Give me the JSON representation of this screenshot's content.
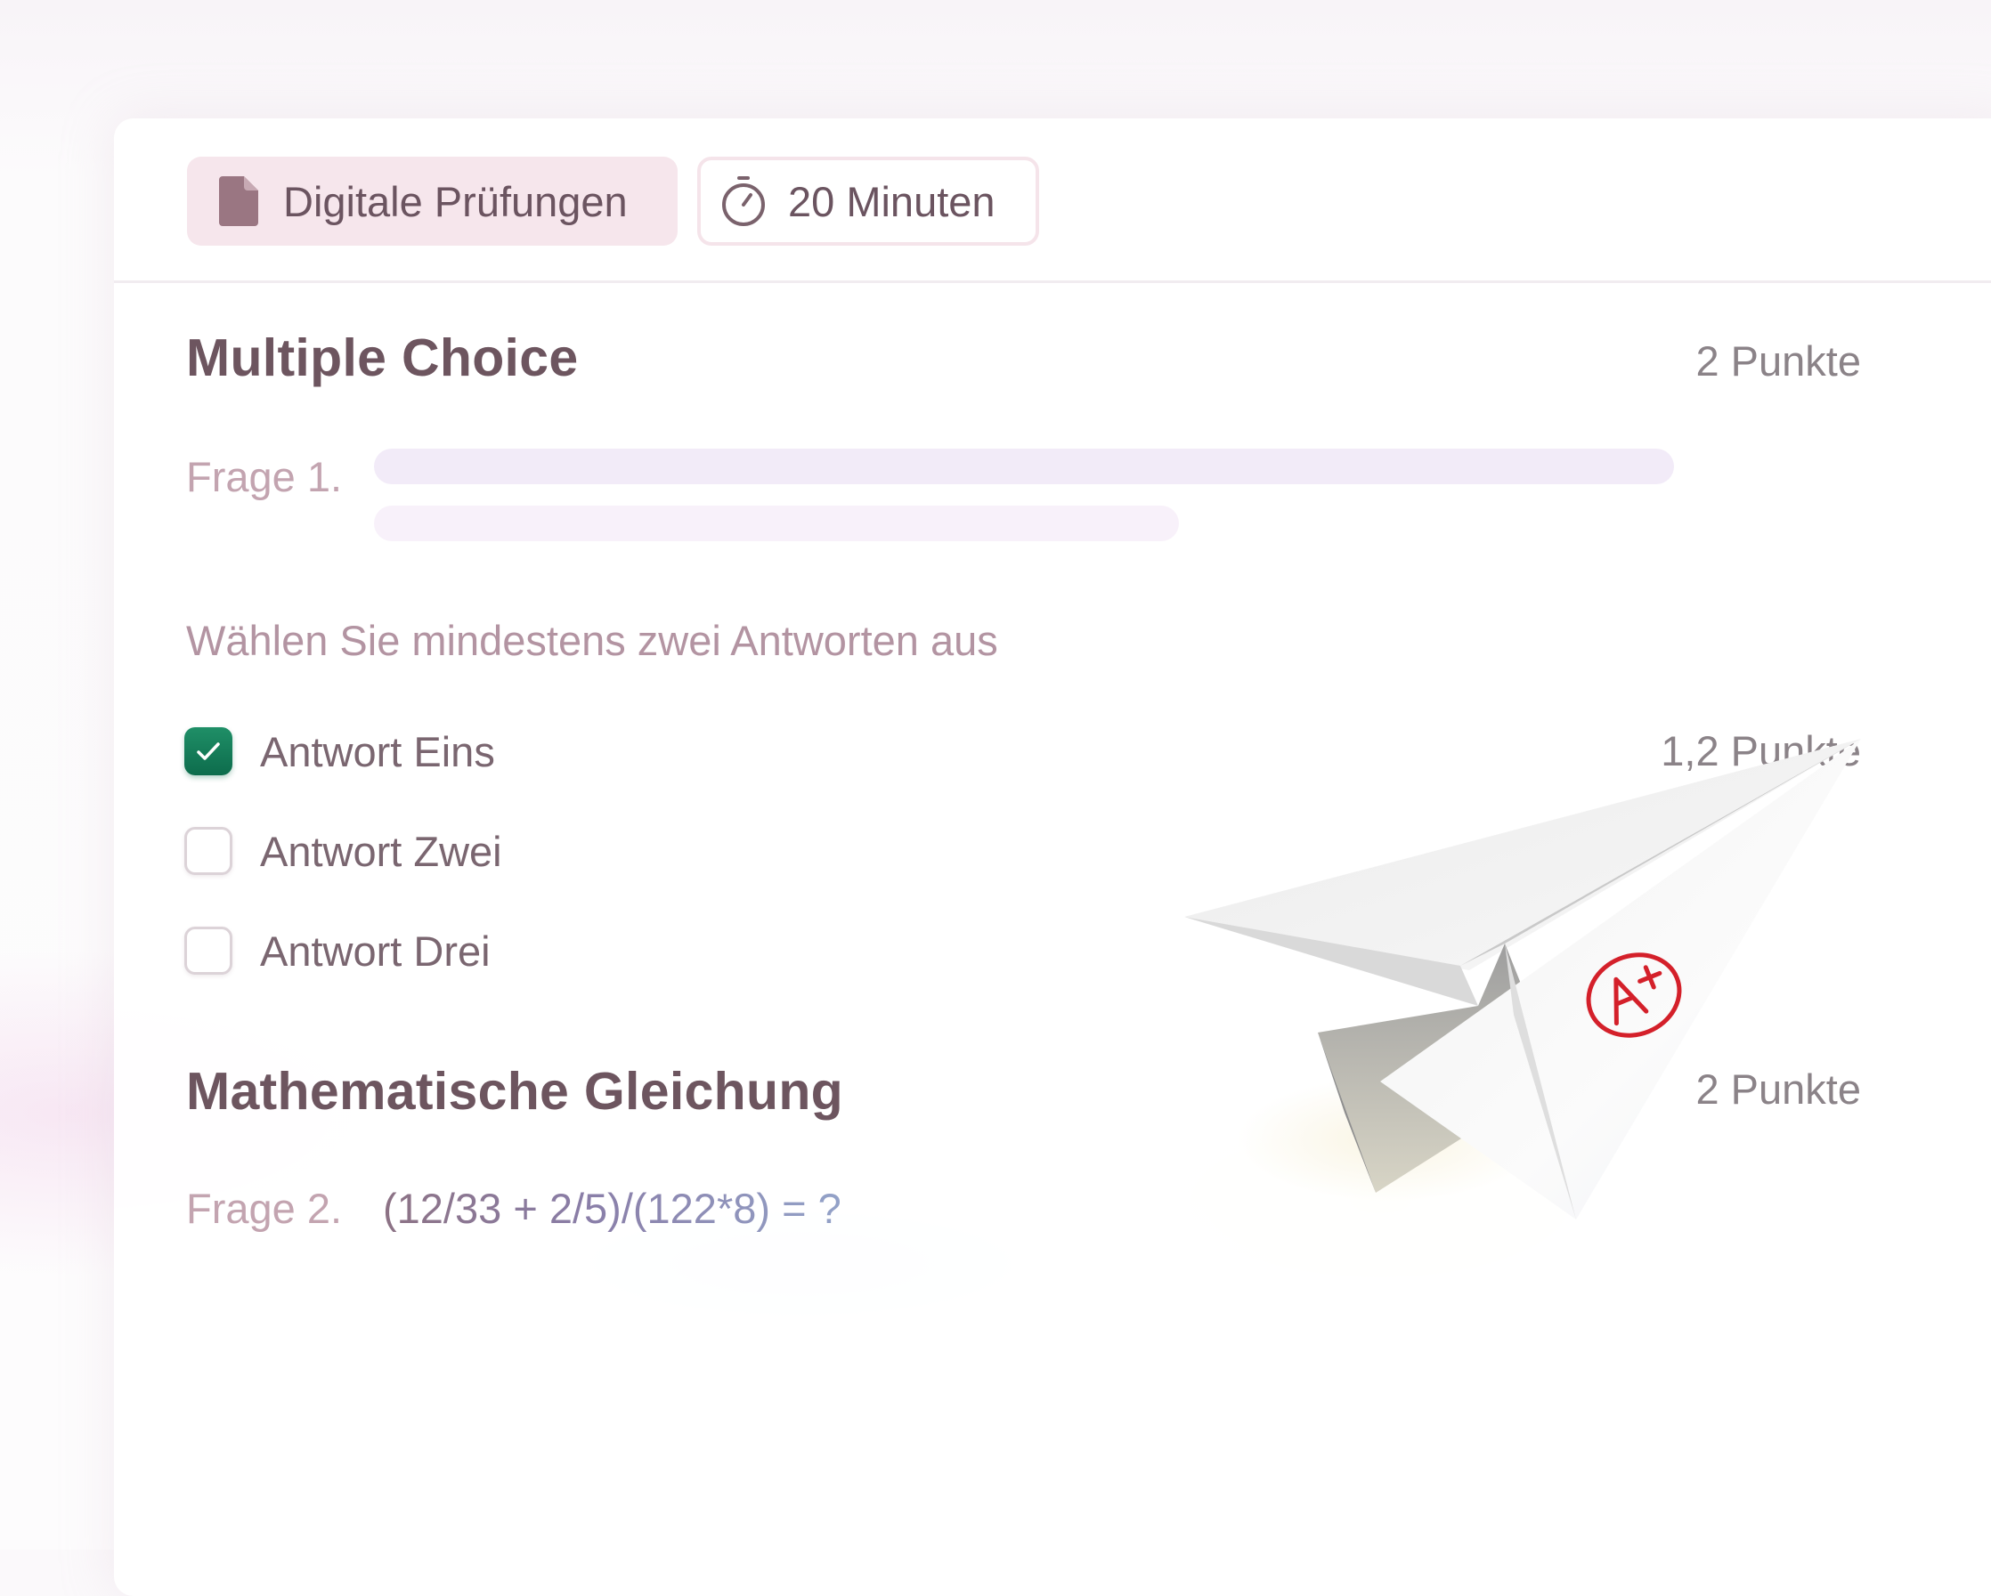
{
  "header": {
    "exam_chip_label": "Digitale Prüfungen",
    "exam_chip_icon": "document-icon",
    "time_chip_label": "20 Minuten",
    "time_chip_icon": "stopwatch-icon"
  },
  "sections": {
    "multiple_choice": {
      "title": "Multiple Choice",
      "points": "2 Punkte",
      "question_label": "Frage 1.",
      "instruction": "Wählen Sie mindestens zwei Antworten aus",
      "answers": [
        {
          "label": "Antwort Eins",
          "checked": true
        },
        {
          "label": "Antwort Zwei",
          "checked": false
        },
        {
          "label": "Antwort Drei",
          "checked": false
        }
      ],
      "answer_points": "1,2 Punkte"
    },
    "math": {
      "title": "Mathematische Gleichung",
      "points": "2 Punkte",
      "question_label": "Frage 2.",
      "equation": "(12/33 + 2/5)/(122*8) = ?"
    }
  },
  "decoration": {
    "paper_plane_icon": "paper-plane-icon",
    "grade_mark": "A+",
    "grade_color": "#d4202a"
  },
  "colors": {
    "accent_green": "#0d6c4c",
    "chip_background": "#f6e6ec",
    "title_color": "#6d555f"
  }
}
